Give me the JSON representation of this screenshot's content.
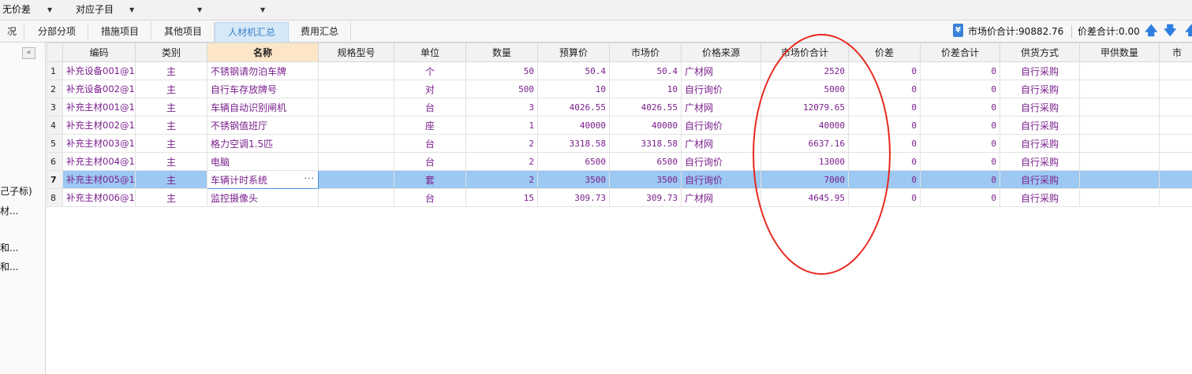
{
  "toolbar": {
    "price_diff_select": "无价差",
    "sub_item_select": "对应子目"
  },
  "tabs": [
    {
      "label": "况",
      "active": false
    },
    {
      "label": "分部分项",
      "active": false
    },
    {
      "label": "措施项目",
      "active": false
    },
    {
      "label": "其他项目",
      "active": false
    },
    {
      "label": "人材机汇总",
      "active": true
    },
    {
      "label": "费用汇总",
      "active": false
    }
  ],
  "summary": {
    "market_total": "市场价合计:90882.76",
    "diff_total": "价差合计:0.00"
  },
  "left_panel": {
    "items": [
      "己子标)",
      "材...",
      "和...",
      "和..."
    ]
  },
  "columns": [
    "",
    "编码",
    "类别",
    "名称",
    "规格型号",
    "单位",
    "数量",
    "预算价",
    "市场价",
    "价格来源",
    "市场价合计",
    "价差",
    "价差合计",
    "供货方式",
    "甲供数量",
    "市"
  ],
  "rows": [
    {
      "idx": "1",
      "code": "补充设备001@1",
      "cat": "主",
      "name": "不锈钢请勿泊车牌",
      "spec": "",
      "unit": "个",
      "qty": "50",
      "budget": "50.4",
      "market": "50.4",
      "source": "广材网",
      "total": "2520",
      "diff": "0",
      "diff_total": "0",
      "supply": "自行采购"
    },
    {
      "idx": "2",
      "code": "补充设备002@1",
      "cat": "主",
      "name": "自行车存放牌号",
      "spec": "",
      "unit": "对",
      "qty": "500",
      "budget": "10",
      "market": "10",
      "source": "自行询价",
      "total": "5000",
      "diff": "0",
      "diff_total": "0",
      "supply": "自行采购"
    },
    {
      "idx": "3",
      "code": "补充主材001@1",
      "cat": "主",
      "name": "车辆自动识别闸机",
      "spec": "",
      "unit": "台",
      "qty": "3",
      "budget": "4026.55",
      "market": "4026.55",
      "source": "广材网",
      "total": "12079.65",
      "diff": "0",
      "diff_total": "0",
      "supply": "自行采购"
    },
    {
      "idx": "4",
      "code": "补充主材002@1",
      "cat": "主",
      "name": "不锈钢值班厅",
      "spec": "",
      "unit": "座",
      "qty": "1",
      "budget": "40000",
      "market": "40000",
      "source": "自行询价",
      "total": "40000",
      "diff": "0",
      "diff_total": "0",
      "supply": "自行采购"
    },
    {
      "idx": "5",
      "code": "补充主材003@1",
      "cat": "主",
      "name": "格力空调1.5匹",
      "spec": "",
      "unit": "台",
      "qty": "2",
      "budget": "3318.58",
      "market": "3318.58",
      "source": "广材网",
      "total": "6637.16",
      "diff": "0",
      "diff_total": "0",
      "supply": "自行采购"
    },
    {
      "idx": "6",
      "code": "补充主材004@1",
      "cat": "主",
      "name": "电脑",
      "spec": "",
      "unit": "台",
      "qty": "2",
      "budget": "6500",
      "market": "6500",
      "source": "自行询价",
      "total": "13000",
      "diff": "0",
      "diff_total": "0",
      "supply": "自行采购"
    },
    {
      "idx": "7",
      "code": "补充主材005@1",
      "cat": "主",
      "name": "车辆计时系统",
      "spec": "",
      "unit": "套",
      "qty": "2",
      "budget": "3500",
      "market": "3500",
      "source": "自行询价",
      "total": "7000",
      "diff": "0",
      "diff_total": "0",
      "supply": "自行采购",
      "selected": true
    },
    {
      "idx": "8",
      "code": "补充主材006@1",
      "cat": "主",
      "name": "监控摄像头",
      "spec": "",
      "unit": "台",
      "qty": "15",
      "budget": "309.73",
      "market": "309.73",
      "source": "广材网",
      "total": "4645.95",
      "diff": "0",
      "diff_total": "0",
      "supply": "自行采购"
    }
  ],
  "colors": {
    "text_purple": "#7a1f8c",
    "selection_blue": "#9cc8f2",
    "active_tab": "#d7e9f9",
    "annotation_red": "#e8281e"
  },
  "icons": {
    "market_total_icon": "yen-icon",
    "move_up": "arrow-up-icon",
    "move_down": "arrow-down-icon",
    "collapse": "double-chevron-left-icon"
  }
}
